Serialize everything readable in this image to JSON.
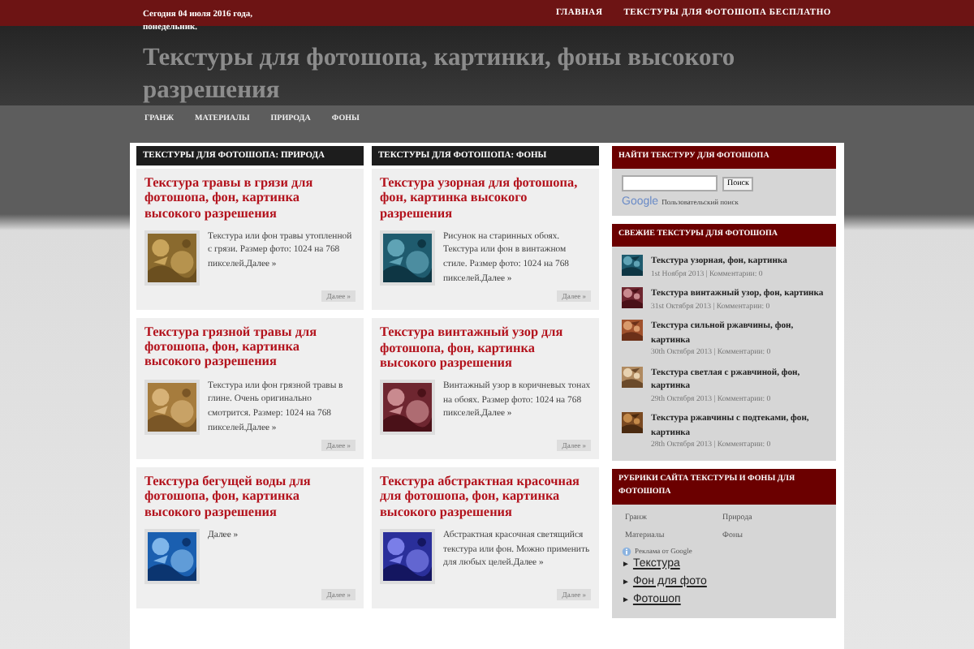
{
  "top_bar": {
    "date": "Сегодня 04 июля 2016 года, понедельник.",
    "links": [
      "ГЛАВНАЯ",
      "ТЕКСТУРЫ ДЛЯ ФОТОШОПА БЕСПЛАТНО"
    ]
  },
  "site_title": "Текстуры для фотошопа, картинки, фоны высокого разрешения",
  "nav": [
    "ГРАНЖ",
    "МАТЕРИАЛЫ",
    "ПРИРОДА",
    "ФОНЫ"
  ],
  "columns": [
    {
      "heading": "ТЕКСТУРЫ ДЛЯ ФОТОШОПА: ПРИРОДА",
      "posts": [
        {
          "title": "Текстура травы в грязи для фотошопа, фон, картинка высокого разрешения",
          "excerpt": "Текстура или фон травы утопленной с грязи. Размер фото: 1024 на 768 пикселей.",
          "more_link": "Далее »",
          "button": "Далее »"
        },
        {
          "title": "Текстура грязной травы для фотошопа, фон, картинка высокого разрешения",
          "excerpt": "Текстура или фон грязной травы в глине. Очень оригинально смотрится. Размер: 1024 на 768 пикселей.",
          "more_link": "Далее »",
          "button": "Далее »"
        },
        {
          "title": "Текстура бегущей воды для фотошопа, фон, картинка высокого разрешения",
          "more_link": "Далее »",
          "button": "Далее »"
        }
      ]
    },
    {
      "heading": "ТЕКСТУРЫ ДЛЯ ФОТОШОПА: ФОНЫ",
      "posts": [
        {
          "title": "Текстура узорная для фотошопа, фон, картинка высокого разрешения",
          "excerpt": "Рисунок на старинных обоях. Текстура или фон в винтажном стиле. Размер фото: 1024 на 768 пикселей.",
          "more_link": "Далее »",
          "button": "Далее »"
        },
        {
          "title": "Текстура винтажный узор для фотошопа, фон, картинка высокого разрешения",
          "excerpt": "Винтажный узор в коричневых тонах на обоях. Размер фото: 1024 на 768 пикселей.",
          "more_link": "Далее »",
          "button": "Далее »"
        },
        {
          "title": "Текстура абстрактная красочная для фотошопа, фон, картинка высокого разрешения",
          "excerpt": "Абстрактная красочная светящийся текстура или фон. Можно применить для любых целей.",
          "more_link": "Далее »",
          "button": "Далее »"
        }
      ]
    }
  ],
  "sidebar": {
    "search": {
      "heading": "НАЙТИ ТЕКСТУРУ ДЛЯ ФОТОШОПА",
      "button": "Поиск",
      "logo": "Google",
      "caption": "Пользовательский поиск"
    },
    "recent": {
      "heading": "СВЕЖИЕ ТЕКСТУРЫ ДЛЯ ФОТОШОПА",
      "items": [
        {
          "title": "Текстура узорная, фон, картинка",
          "meta": "1st Ноября 2013 | Комментарии: 0"
        },
        {
          "title": "Текстура винтажный узор, фон, картинка",
          "meta": "31st Октября 2013 | Комментарии: 0"
        },
        {
          "title": "Текстура сильной ржавчины, фон, картинка",
          "meta": "30th Октября 2013 | Комментарии: 0"
        },
        {
          "title": "Текстура светлая с ржавчиной, фон, картинка",
          "meta": "29th Октября 2013 | Комментарии: 0"
        },
        {
          "title": "Текстура ржавчины с подтеками, фон, картинка",
          "meta": "28th Октября 2013 | Комментарии: 0"
        }
      ]
    },
    "categories": {
      "heading": "РУБРИКИ САЙТА ТЕКСТУРЫ И ФОНЫ ДЛЯ ФОТОШОПА",
      "items": [
        "Гранж",
        "Природа",
        "Материалы",
        "Фоны"
      ]
    },
    "ads": {
      "label": "Реклама от Google",
      "links": [
        {
          "arrow": "►",
          "text": "Текстура"
        },
        {
          "arrow": "►",
          "text": "Фон для фото"
        },
        {
          "arrow": "►",
          "text": "Фотошоп"
        }
      ]
    }
  }
}
